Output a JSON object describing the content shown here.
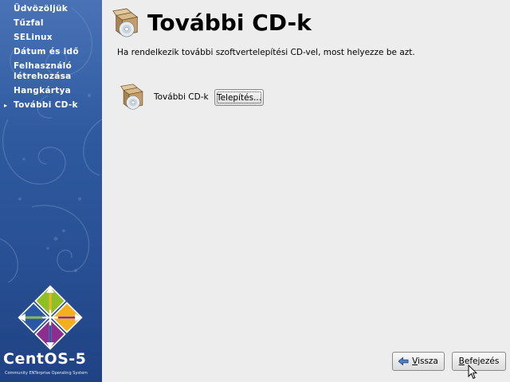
{
  "sidebar": {
    "steps": [
      {
        "label": "Üdvözöljük",
        "active": false
      },
      {
        "label": "Tűzfal",
        "active": false
      },
      {
        "label": "SELinux",
        "active": false
      },
      {
        "label": "Dátum és idő",
        "active": false
      },
      {
        "label": "Felhasználó\nlétrehozása",
        "active": false
      },
      {
        "label": "Hangkártya",
        "active": false
      },
      {
        "label": "További CD-k",
        "active": true
      }
    ],
    "active_marker": "▸",
    "brand": "CentOS-5",
    "brand_sub": "Community ENTerprise Operating System"
  },
  "header": {
    "title": "További CD-k",
    "icon": "software-box-cd-icon"
  },
  "main": {
    "description": "Ha rendelkezik további szoftvertelepítési CD-vel, most helyezze be azt.",
    "cd_row": {
      "label": "További CD-k",
      "icon": "software-box-cd-icon",
      "install_button": "Telepítés..."
    }
  },
  "footer": {
    "back_button": {
      "mnemonic": "V",
      "rest": "issza",
      "icon": "back-arrow-icon"
    },
    "finish_button": {
      "mnemonic": "B",
      "rest": "efejezés"
    }
  },
  "colors": {
    "sidebar_top": "#4a73b6",
    "sidebar_bottom": "#1f4283",
    "background": "#ededed",
    "logo_yellow": "#f2b01e",
    "logo_green": "#8fbf25",
    "logo_blue": "#2a57a6",
    "logo_purple": "#8c2e8f"
  }
}
